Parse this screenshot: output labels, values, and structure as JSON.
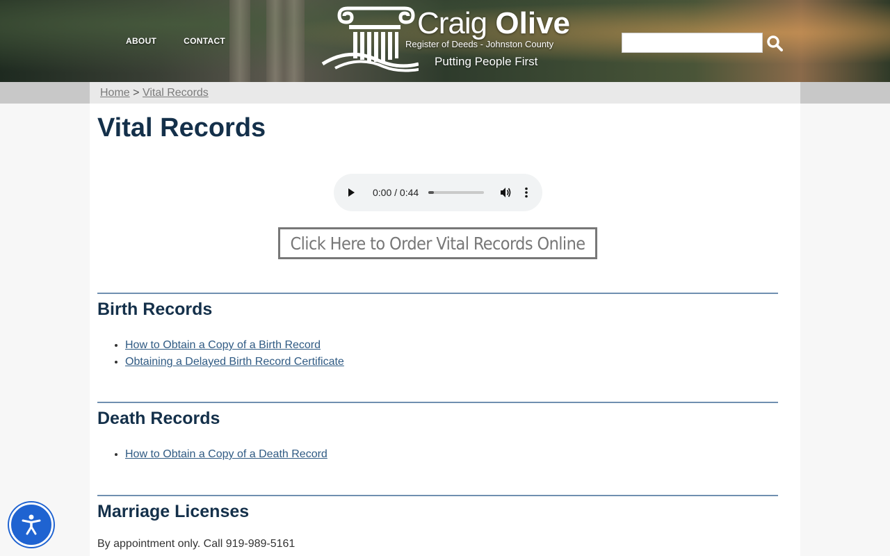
{
  "nav": {
    "about": "ABOUT",
    "contact": "CONTACT"
  },
  "logo": {
    "first": "Craig",
    "last": "Olive",
    "subtitle": "Register of Deeds - Johnston County",
    "tagline": "Putting People First"
  },
  "search": {
    "value": "",
    "placeholder": "",
    "icon": "search-icon"
  },
  "breadcrumb": {
    "home": "Home",
    "separator": ">",
    "current": "Vital Records"
  },
  "page": {
    "title": "Vital Records"
  },
  "audio": {
    "time": "0:00 / 0:44",
    "progress": 0.1
  },
  "order_button": "Click Here to Order Vital Records Online",
  "sections": [
    {
      "heading": "Birth Records",
      "links": [
        "How to Obtain a Copy of a Birth Record",
        "Obtaining a Delayed Birth Record Certificate"
      ]
    },
    {
      "heading": "Death Records",
      "links": [
        "How to Obtain a Copy of a Death Record"
      ]
    },
    {
      "heading": "Marriage Licenses",
      "text": "By appointment only. Call 919-989-5161"
    }
  ],
  "colors": {
    "heading": "#14304a",
    "link": "#2f5a83",
    "rule": "#6f8fb0",
    "accessibility": "#1f63d1"
  },
  "accessibility_icon": "accessibility-icon"
}
